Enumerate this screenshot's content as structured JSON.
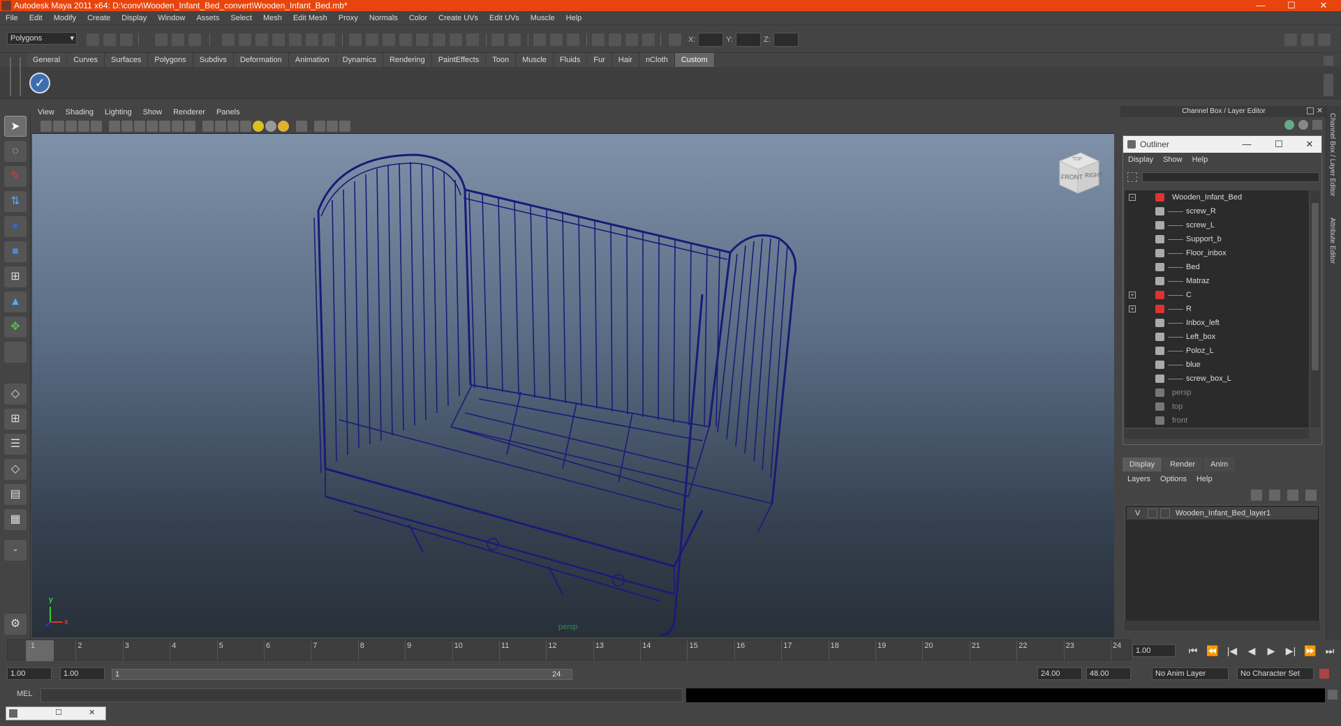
{
  "window": {
    "title": "Autodesk Maya 2011 x64: D:\\conv\\Wooden_Infant_Bed_convert\\Wooden_Infant_Bed.mb*",
    "minimize": "—",
    "maximize": "☐",
    "close": "✕"
  },
  "menubar": [
    "File",
    "Edit",
    "Modify",
    "Create",
    "Display",
    "Window",
    "Assets",
    "Select",
    "Mesh",
    "Edit Mesh",
    "Proxy",
    "Normals",
    "Color",
    "Create UVs",
    "Edit UVs",
    "Muscle",
    "Help"
  ],
  "toolbar": {
    "mode": "Polygons",
    "x_label": "X:",
    "y_label": "Y:",
    "z_label": "Z:"
  },
  "shelf_tabs": [
    "General",
    "Curves",
    "Surfaces",
    "Polygons",
    "Subdivs",
    "Deformation",
    "Animation",
    "Dynamics",
    "Rendering",
    "PaintEffects",
    "Toon",
    "Muscle",
    "Fluids",
    "Fur",
    "Hair",
    "nCloth",
    "Custom"
  ],
  "shelf_active": "Custom",
  "viewport": {
    "menu": [
      "View",
      "Shading",
      "Lighting",
      "Show",
      "Renderer",
      "Panels"
    ],
    "camera_label": "persp",
    "cube_front": "FRONT",
    "cube_right": "RIGHT",
    "cube_top": "TOP",
    "axis_x": "x",
    "axis_y": "y",
    "wire_color": "#1a1a78"
  },
  "channel_box": {
    "header": "Channel Box / Layer Editor"
  },
  "side_tabs": {
    "channel": "Channel Box / Layer Editor",
    "attribute": "Attribute Editor"
  },
  "outliner": {
    "title": "Outliner",
    "menu": [
      "Display",
      "Show",
      "Help"
    ],
    "items": [
      {
        "label": "Wooden_Infant_Bed",
        "type": "group",
        "expander": "−"
      },
      {
        "label": "screw_R",
        "type": "mesh"
      },
      {
        "label": "screw_L",
        "type": "mesh"
      },
      {
        "label": "Support_b",
        "type": "mesh"
      },
      {
        "label": "Floor_inbox",
        "type": "mesh"
      },
      {
        "label": "Bed",
        "type": "mesh"
      },
      {
        "label": "Matraz",
        "type": "mesh"
      },
      {
        "label": "C",
        "type": "group",
        "expander": "+"
      },
      {
        "label": "R",
        "type": "group",
        "expander": "+"
      },
      {
        "label": "Inbox_left",
        "type": "mesh"
      },
      {
        "label": "Left_box",
        "type": "mesh"
      },
      {
        "label": "Poloz_L",
        "type": "mesh"
      },
      {
        "label": "blue",
        "type": "mesh"
      },
      {
        "label": "screw_box_L",
        "type": "mesh"
      },
      {
        "label": "persp",
        "type": "camera"
      },
      {
        "label": "top",
        "type": "camera"
      },
      {
        "label": "front",
        "type": "camera"
      }
    ]
  },
  "layer_editor": {
    "tabs": [
      "Display",
      "Render",
      "Anim"
    ],
    "active_tab": "Display",
    "menu": [
      "Layers",
      "Options",
      "Help"
    ],
    "layer_visibility": "V",
    "layer_name": "Wooden_Infant_Bed_layer1"
  },
  "timeline": {
    "start": 1,
    "end": 24,
    "current_frame": 1,
    "current_frame_text": "1.00",
    "playback": [
      "⏮",
      "⏪",
      "|◀",
      "◀",
      "▶",
      "▶|",
      "⏩",
      "⏭"
    ]
  },
  "range": {
    "start_time": "1.00",
    "playback_start": "1.00",
    "slider_start": "1",
    "slider_end": "24",
    "playback_end": "24.00",
    "end_time": "48.00",
    "anim_layer": "No Anim Layer",
    "character_set": "No Character Set"
  },
  "command_line": {
    "label": "MEL"
  }
}
